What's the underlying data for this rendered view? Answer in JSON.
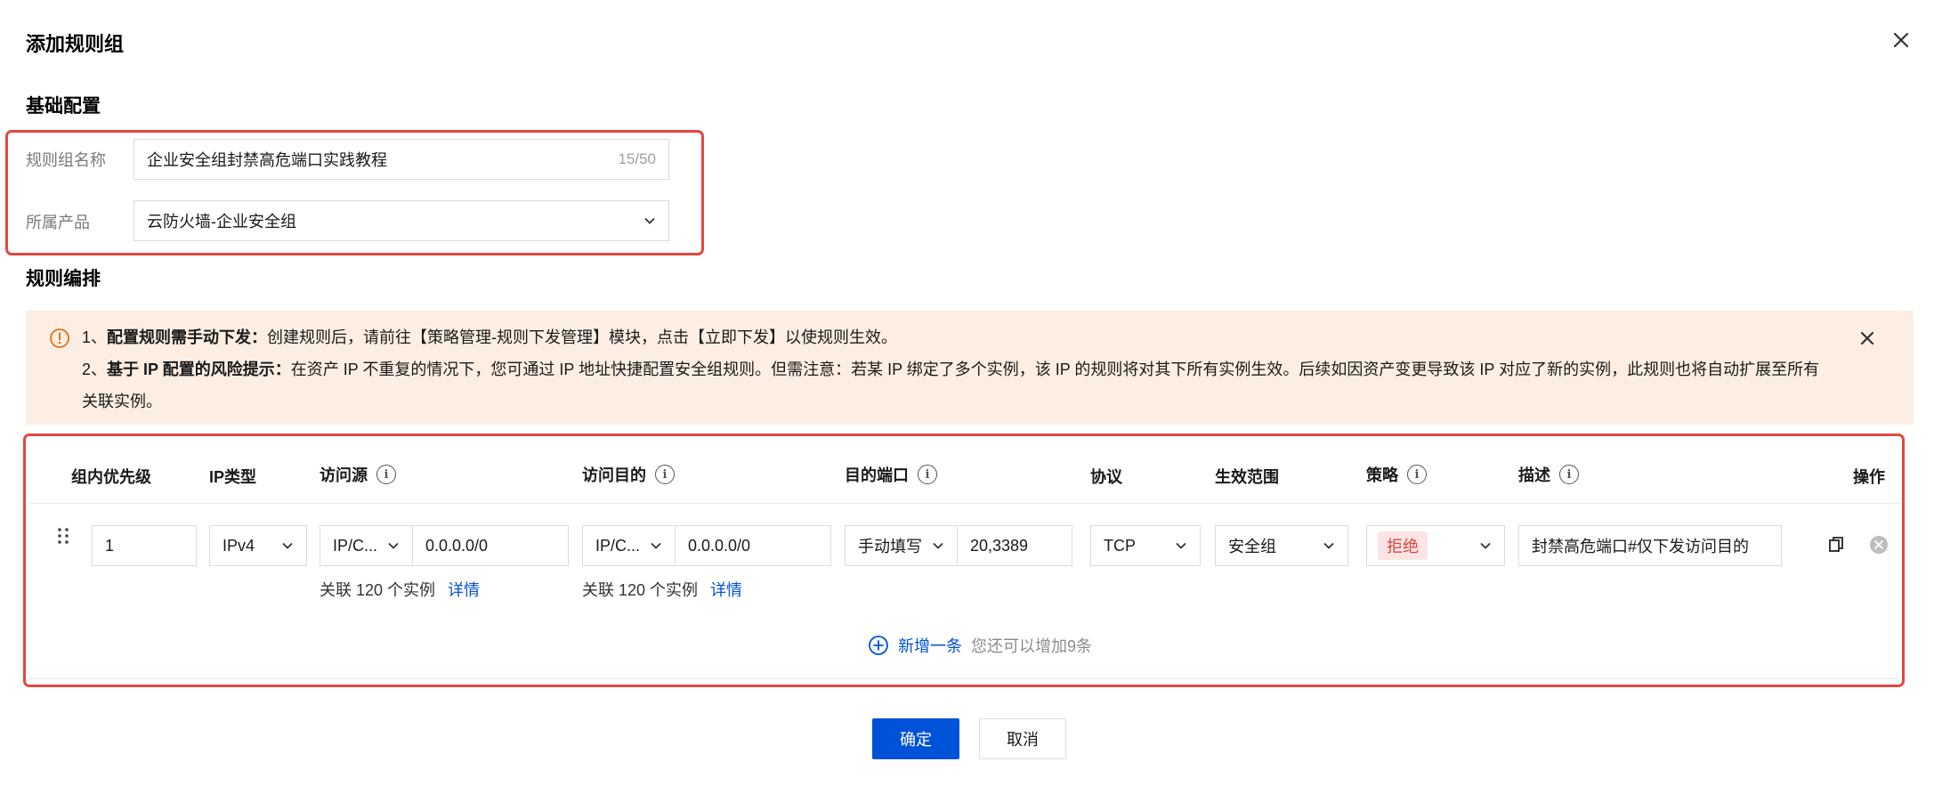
{
  "dialog": {
    "title": "添加规则组"
  },
  "basic_config": {
    "section_title": "基础配置",
    "name_label": "规则组名称",
    "name_value": "企业安全组封禁高危端口实践教程",
    "name_counter": "15/50",
    "product_label": "所属产品",
    "product_value": "云防火墙-企业安全组"
  },
  "rules": {
    "section_title": "规则编排",
    "alert": {
      "line1_prefix": "1、",
      "line1_bold": "配置规则需手动下发：",
      "line1_text": "创建规则后，请前往【策略管理-规则下发管理】模块，点击【立即下发】以使规则生效。",
      "line2_prefix": "2、",
      "line2_bold": "基于 IP 配置的风险提示：",
      "line2_text": "在资产 IP 不重复的情况下，您可通过 IP 地址快捷配置安全组规则。但需注意：若某 IP 绑定了多个实例，该 IP 的规则将对其下所有实例生效。后续如因资产变更导致该 IP 对应了新的实例，此规则也将自动扩展至所有",
      "line3_text": "关联实例。"
    },
    "headers": {
      "priority": "组内优先级",
      "ip_type": "IP类型",
      "source": "访问源",
      "destination": "访问目的",
      "dest_port": "目的端口",
      "protocol": "协议",
      "scope": "生效范围",
      "policy": "策略",
      "description": "描述",
      "actions": "操作"
    },
    "row": {
      "priority": "1",
      "ip_type": "IPv4",
      "source_type": "IP/C...",
      "source_value": "0.0.0.0/0",
      "source_assoc": "关联 120 个实例",
      "source_detail": "详情",
      "dest_type": "IP/C...",
      "dest_value": "0.0.0.0/0",
      "dest_assoc": "关联 120 个实例",
      "dest_detail": "详情",
      "port_mode": "手动填写",
      "port_value": "20,3389",
      "protocol": "TCP",
      "scope": "安全组",
      "policy": "拒绝",
      "description": "封禁高危端口#仅下发访问目的"
    },
    "add_label": "新增一条",
    "add_hint": "您还可以增加9条"
  },
  "footer": {
    "confirm": "确定",
    "cancel": "取消"
  },
  "colors": {
    "primary": "#0052d9",
    "highlight_border": "#e5473e",
    "alert_bg": "#fdeee3",
    "deny_tag_bg": "#fde4e4",
    "deny_tag_text": "#d54941"
  }
}
